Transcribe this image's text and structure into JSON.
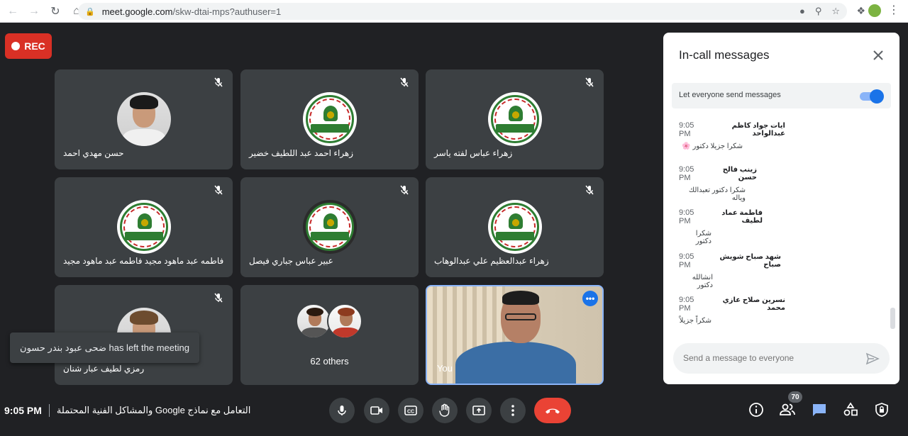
{
  "browser": {
    "url_host": "meet.google.com",
    "url_path": "/skw-dtai-mps?authuser=1"
  },
  "rec": {
    "label": "REC"
  },
  "tiles": [
    {
      "name": "حسن مهدي احمد"
    },
    {
      "name": "زهراء احمد عبد اللطيف خضير"
    },
    {
      "name": "زهراء عباس لفته ياسر"
    },
    {
      "name": "فاطمه عبد ماهود مجيد فاطمه عبد ماهود مجيد"
    },
    {
      "name": "عبير عباس جباري فيصل"
    },
    {
      "name": "زهراء عبدالعظيم علي عبدالوهاب"
    },
    {
      "name": "رمزي لطيف عبار شنان"
    },
    {
      "name": "62 others"
    },
    {
      "name": "You"
    }
  ],
  "toast": {
    "text": "ضحى عبود بندر حسون has left the meeting"
  },
  "meeting": {
    "time": "9:05 PM",
    "title": "التعامل مع نماذج Google والمشاكل الفنية المحتملة"
  },
  "participants_count": "70",
  "chat": {
    "title": "In-call messages",
    "toggle_label": "Let everyone send messages",
    "messages": [
      {
        "sender": "ايات جواد كاظم عبدالواحد",
        "time": "9:05 PM",
        "text": "شكرا جزيلا دكتور 🌸"
      },
      {
        "sender": "زينب فالح حسن",
        "time": "9:05 PM",
        "text": "شكرا دكتور تعبدالك وياله"
      },
      {
        "sender": "فاطمة عماد لطيف",
        "time": "9:05 PM",
        "text": "شكرا دكتور"
      },
      {
        "sender": "شهد صباح شويش صباح",
        "time": "9:05 PM",
        "text": "انشالله دكتور"
      },
      {
        "sender": "نسرين صلاح عازي محمد",
        "time": "9:05 PM",
        "text": "شكراً جزيلاً"
      }
    ],
    "input_placeholder": "Send a message to everyone"
  }
}
